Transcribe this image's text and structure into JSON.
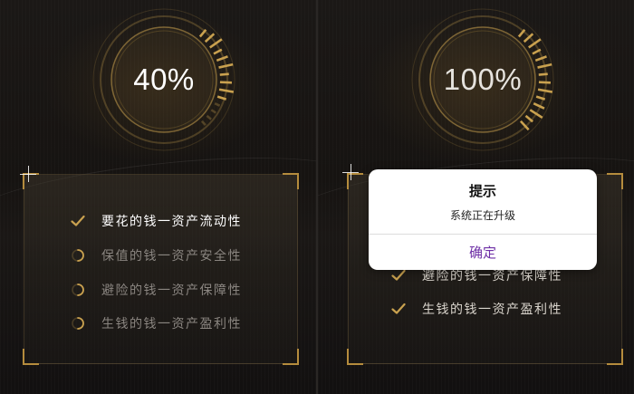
{
  "left_screen": {
    "progress_label": "40%",
    "progress": 0.4,
    "checklist": [
      {
        "label": "要花的钱一资产流动性",
        "status": "done"
      },
      {
        "label": "保值的钱一资产安全性",
        "status": "loading"
      },
      {
        "label": "避险的钱一资产保障性",
        "status": "loading"
      },
      {
        "label": "生钱的钱一资产盈利性",
        "status": "loading"
      }
    ]
  },
  "right_screen": {
    "progress_label": "100%",
    "progress": 1.0,
    "checklist": [
      {
        "label": "避险的钱一资产保障性",
        "status": "done"
      },
      {
        "label": "生钱的钱一资产盈利性",
        "status": "done"
      }
    ],
    "dialog": {
      "title": "提示",
      "message": "系统正在升级",
      "confirm_label": "确定"
    }
  },
  "colors": {
    "gold": "#c9a14f",
    "accent_purple": "#6e2fa6",
    "background": "#161311"
  },
  "icons": {
    "done": "check-icon",
    "loading": "loading-spinner-icon"
  }
}
